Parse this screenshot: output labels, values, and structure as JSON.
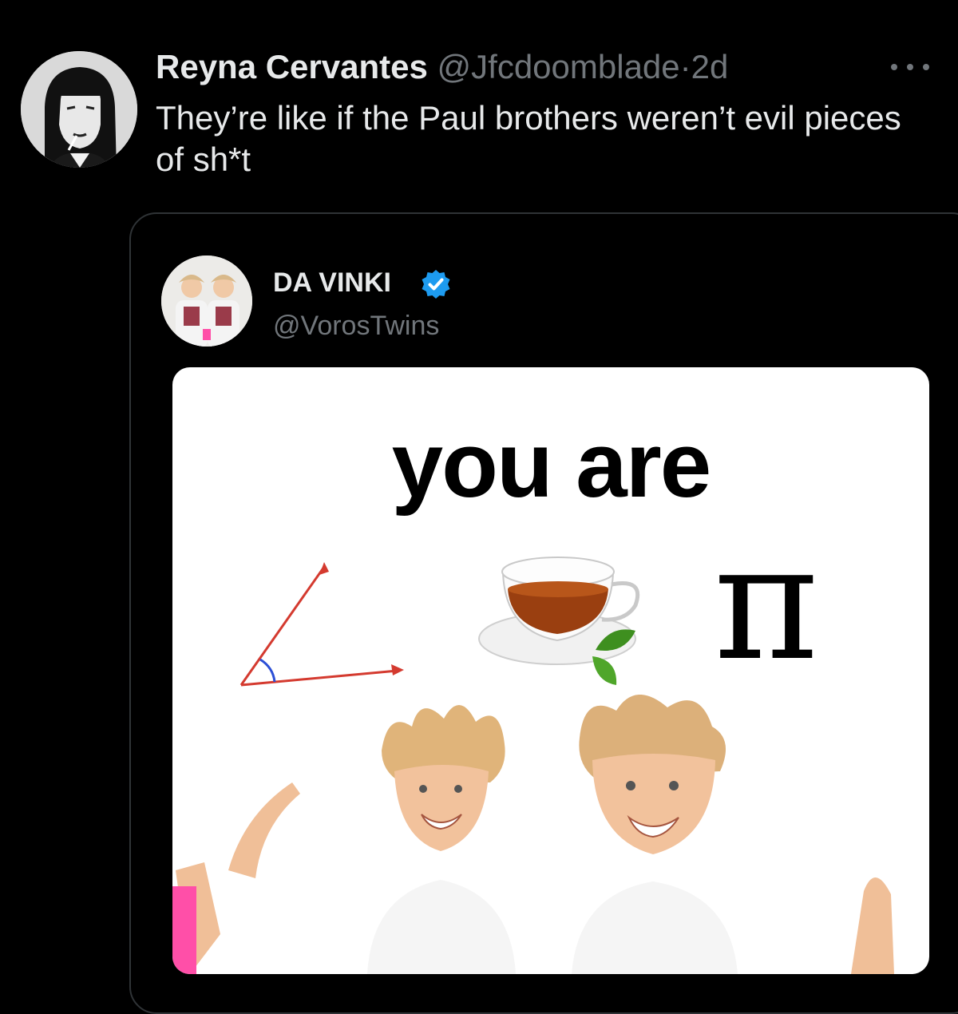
{
  "reply": {
    "name": "Reyna Cervantes",
    "handle": "@Jfcdoomblade",
    "separator": "·",
    "time": "2d",
    "text": "They’re like if the Paul brothers weren’t evil pieces of sh*t",
    "more_icon": "more-horizontal-icon"
  },
  "quote": {
    "name": "DA VINKI",
    "verified_icon": "verified-badge-icon",
    "handle": "@VorosTwins",
    "image": {
      "caption": "you are",
      "symbols": [
        "angle-icon",
        "tea-cup-icon",
        "pi-symbol"
      ],
      "pi_glyph": "π"
    }
  },
  "colors": {
    "background": "#000000",
    "text": "#e7e9ea",
    "muted": "#71767b",
    "verified": "#1d9bf0",
    "border": "#2f3336"
  }
}
